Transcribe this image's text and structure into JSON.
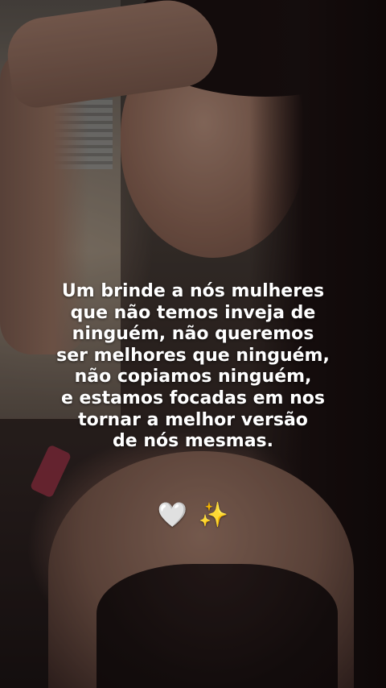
{
  "caption": {
    "lines": [
      "Um brinde a nós mulheres",
      "que não temos inveja de",
      "ninguém, não queremos",
      "ser melhores que ninguém,",
      "não copiamos ninguém,",
      "e estamos focadas em nos",
      "tornar a melhor versão",
      "de nós mesmas."
    ]
  },
  "emojis": {
    "heart": "🤍",
    "sparkles": "✨",
    "heart_icon": "white-heart-icon",
    "sparkles_icon": "sparkles-icon"
  },
  "colors": {
    "text": "#ffffff",
    "sparkles": "#ffd84a",
    "heart": "#f4f4f4"
  }
}
